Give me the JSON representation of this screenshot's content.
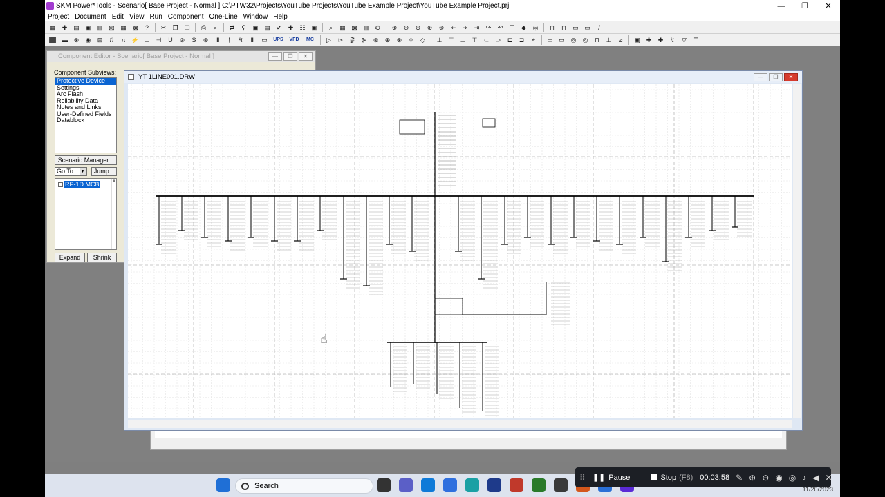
{
  "window": {
    "title": "SKM Power*Tools - Scenario[ Base Project - Normal ] C:\\PTW32\\Projects\\YouTube Projects\\YouTube Example Project\\YouTube Example Project.prj",
    "minimize": "—",
    "maximize": "❐",
    "close": "✕"
  },
  "menubar": {
    "items": [
      "Project",
      "Document",
      "Edit",
      "View",
      "Run",
      "Component",
      "One-Line",
      "Window",
      "Help"
    ]
  },
  "toolbar1": {
    "icons": [
      "▦",
      "✚",
      "▤",
      "▣",
      "▥",
      "▧",
      "▦",
      "▩",
      "?",
      "|",
      "✂",
      "❐",
      "❏",
      "|",
      "⎙",
      "⌕",
      "|",
      "⇄",
      "⚲",
      "▣",
      "▤",
      "✔",
      "✚",
      "☷",
      "▣",
      "|",
      "⌕",
      "▦",
      "▩",
      "▥",
      "⛭",
      "|",
      "⊕",
      "⊖",
      "⊖",
      "⊕",
      "⊛",
      "⇤",
      "⇥",
      "⇥",
      "↷",
      "↶",
      "T",
      "◆",
      "◎",
      "|",
      "⊓",
      "⊓",
      "▭",
      "▭",
      "/"
    ]
  },
  "toolbar2": {
    "icons": [
      "⬛",
      "▬",
      "⊗",
      "◉",
      "⊞",
      "ℏ",
      "π",
      "⚡",
      "⊥",
      "⊣",
      "U",
      "⊘",
      "S",
      "⊛",
      "Ⅲ",
      "†",
      "↯",
      "Ⅲ",
      "▭",
      "UPS",
      "VFD",
      "MC",
      "|",
      "▷",
      "⊳",
      "⋛",
      "⊱",
      "⊛",
      "⊕",
      "⊗",
      "◊",
      "◇",
      "|",
      "⊥",
      "⊤",
      "⊥",
      "⊤",
      "⊂",
      "⊃",
      "⊏",
      "⊐",
      "⌖",
      "|",
      "▭",
      "▭",
      "◎",
      "◎",
      "⊓",
      "⊥",
      "⊿",
      "|",
      "▣",
      "✚",
      "✚",
      "↯",
      "▽",
      "T"
    ]
  },
  "component_editor": {
    "title": "Component Editor - Scenario[ Base Project - Normal ]",
    "subviews_label": "Component Subviews:",
    "subviews": [
      "Protective Device",
      "Settings",
      "Arc Flash",
      "Reliability Data",
      "Notes and Links",
      "User-Defined Fields",
      "Datablock"
    ],
    "selected_subview": "Protective Device",
    "scenario_manager": "Scenario Manager...",
    "goto": "Go To",
    "jump": "Jump...",
    "tree_item": "RP-1D MCB",
    "expand": "Expand",
    "shrink": "Shrink"
  },
  "drawing_window": {
    "title": "YT 1LINE001.DRW"
  },
  "taskbar": {
    "search": "Search",
    "date": "11/20/2023",
    "icon_colors": [
      "#1f6fd6",
      "#a23bd0",
      "#333",
      "#5b5fc7",
      "#0e7ad8",
      "#2f6fde",
      "#1aa0a4",
      "#1e3a8a",
      "#c0392b",
      "#2a7a2a",
      "#3a3a3a",
      "#d4571c",
      "#2a6fd6",
      "#5a2ad6"
    ]
  },
  "recorder": {
    "pause": "Pause",
    "stop": "Stop",
    "stop_key": "(F8)",
    "timer": "00:03:58"
  }
}
